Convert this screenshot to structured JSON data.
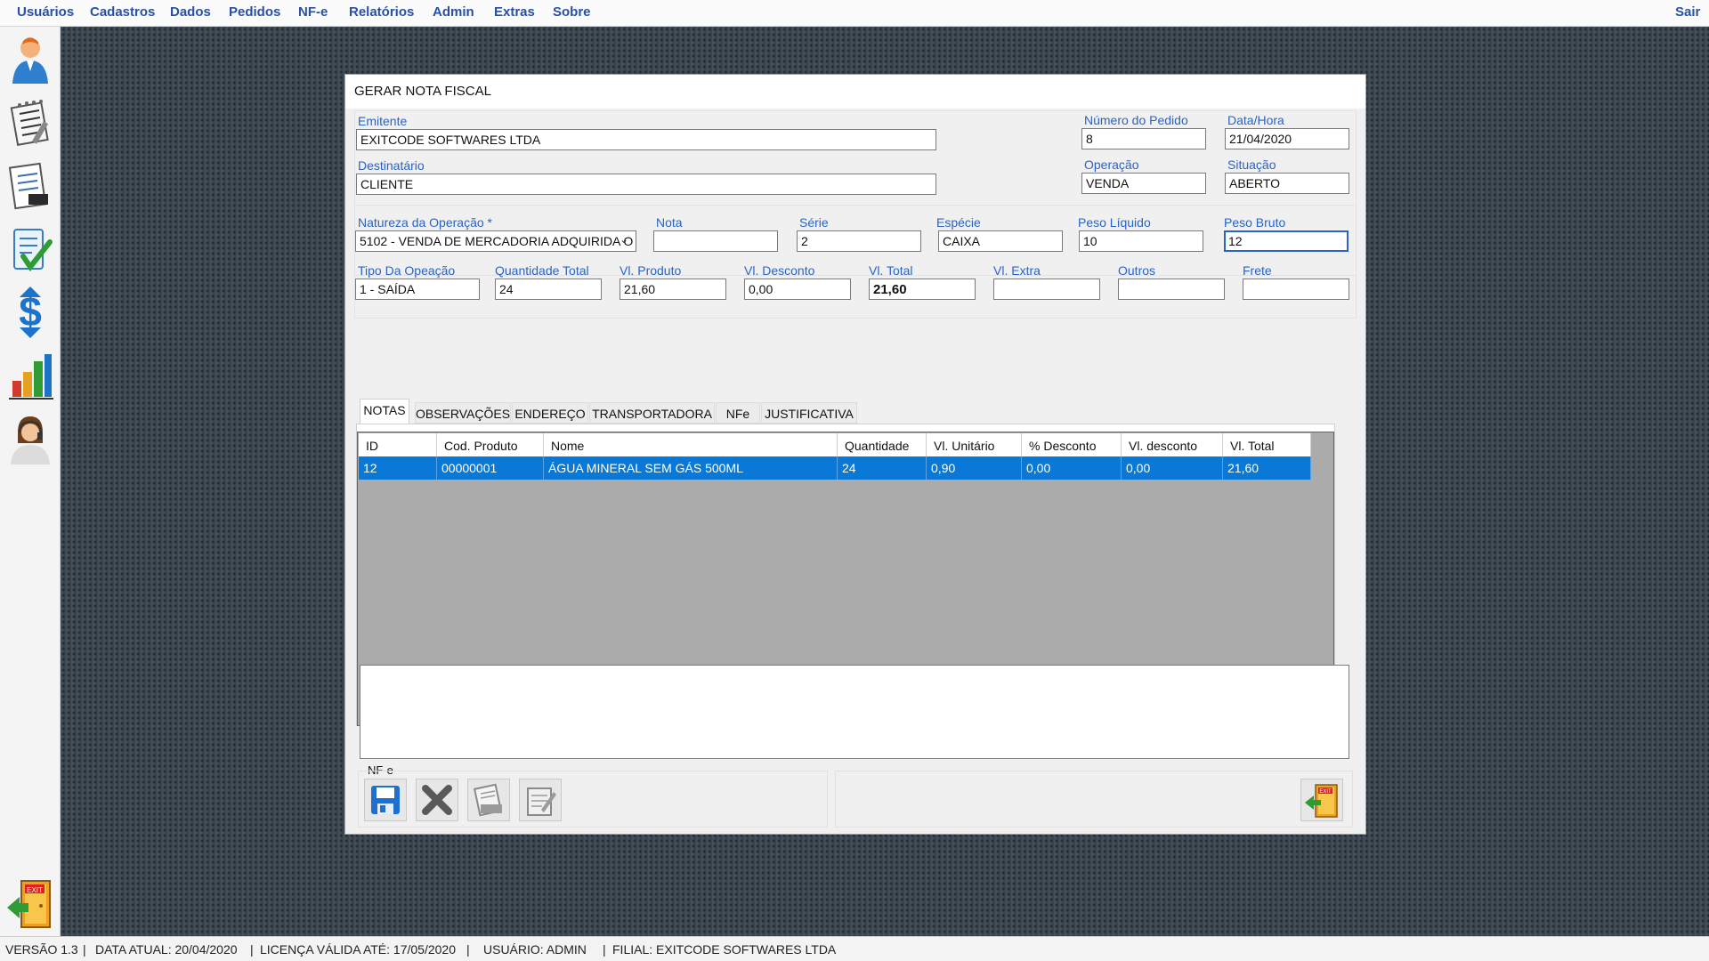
{
  "menu": {
    "items": [
      "Usuários",
      "Cadastros",
      "Dados",
      "Pedidos",
      "NF-e",
      "Relatórios",
      "Admin",
      "Extras",
      "Sobre"
    ],
    "exit": "Sair"
  },
  "sidebar": {
    "icons": [
      "user-icon",
      "notepad-icon",
      "document-icon",
      "checklist-icon",
      "money-icon",
      "chart-icon",
      "attendant-icon"
    ],
    "exit_icon": "exit-door-icon"
  },
  "dialog": {
    "title": "GERAR NOTA FISCAL",
    "emitente": {
      "label": "Emitente",
      "value": "EXITCODE SOFTWARES LTDA"
    },
    "destinatario": {
      "label": "Destinatário",
      "value": "CLIENTE"
    },
    "numero_pedido": {
      "label": "Número do Pedido",
      "value": "8"
    },
    "data_hora": {
      "label": "Data/Hora",
      "value": "21/04/2020"
    },
    "operacao": {
      "label": "Operação",
      "value": "VENDA"
    },
    "situacao": {
      "label": "Situação",
      "value": "ABERTO"
    },
    "natureza": {
      "label": "Natureza da Operação *",
      "value": "5102 - VENDA DE MERCADORIA ADQUIRIDA O"
    },
    "nota": {
      "label": "Nota",
      "value": ""
    },
    "serie": {
      "label": "Série",
      "value": "2"
    },
    "especie": {
      "label": "Espécie",
      "value": "CAIXA"
    },
    "peso_liquido": {
      "label": "Peso Líquido",
      "value": "10"
    },
    "peso_bruto": {
      "label": "Peso Bruto",
      "value": "12"
    },
    "tipo_operacao": {
      "label": "Tipo Da Opeação",
      "value": "1 - SAÍDA"
    },
    "quantidade_total": {
      "label": "Quantidade Total",
      "value": "24"
    },
    "vl_produto": {
      "label": "Vl. Produto",
      "value": "21,60"
    },
    "vl_desconto": {
      "label": "Vl. Desconto",
      "value": "0,00"
    },
    "vl_total": {
      "label": "Vl. Total",
      "value": "21,60"
    },
    "vl_extra": {
      "label": "Vl. Extra",
      "value": ""
    },
    "outros": {
      "label": "Outros",
      "value": ""
    },
    "frete": {
      "label": "Frete",
      "value": ""
    },
    "tabs": [
      "NOTAS",
      "OBSERVAÇÕES",
      "ENDEREÇO",
      "TRANSPORTADORA",
      "NFe",
      "JUSTIFICATIVA"
    ],
    "grid": {
      "columns": [
        "ID",
        "Cod. Produto",
        "Nome",
        "Quantidade",
        "Vl. Unitário",
        "% Desconto",
        "Vl. desconto",
        "Vl. Total"
      ],
      "rows": [
        [
          "12",
          "00000001",
          "ÁGUA MINERAL SEM GÁS 500ML",
          "24",
          "0,90",
          "0,00",
          "0,00",
          "21,60"
        ]
      ]
    },
    "nfe_group_label": "NF-e",
    "buttons": [
      "save-icon",
      "cancel-x-icon",
      "print-icon",
      "edit-document-icon",
      "exit-door-icon"
    ]
  },
  "status": {
    "versao": "VERSÃO 1.3",
    "data_atual": "DATA ATUAL: 20/04/2020",
    "licenca": "LICENÇA VÁLIDA ATÉ: 17/05/2020",
    "usuario": "USUÁRIO: ADMIN",
    "filial": "FILIAL: EXITCODE SOFTWARES LTDA",
    "separator": "|"
  }
}
